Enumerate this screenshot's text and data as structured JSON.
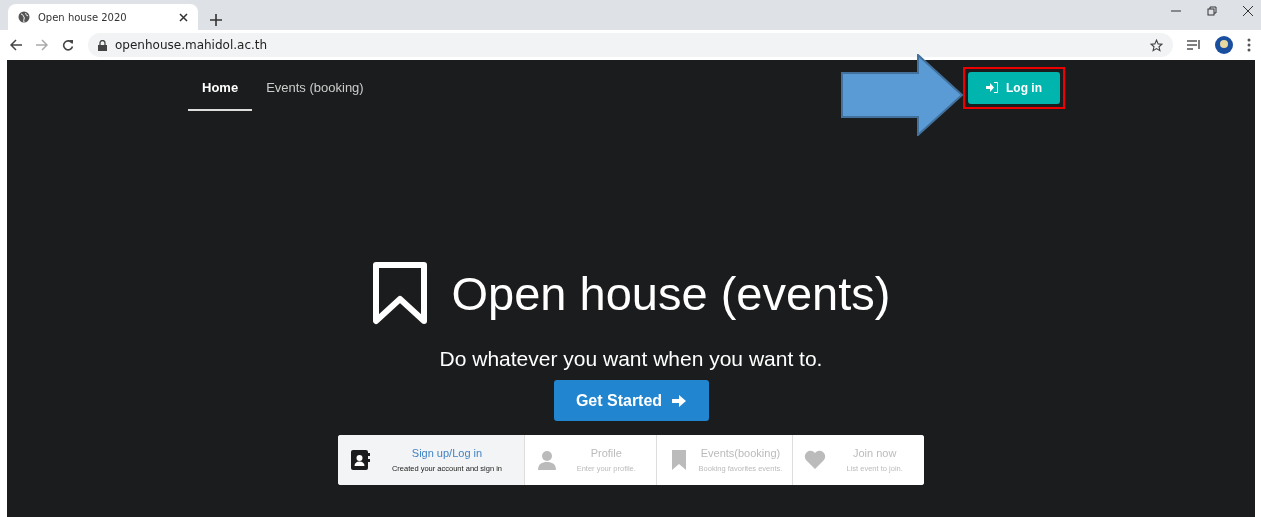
{
  "browser": {
    "tab_title": "Open house 2020",
    "url": "openhouse.mahidol.ac.th"
  },
  "nav": {
    "items": [
      {
        "label": "Home",
        "selected": true
      },
      {
        "label": "Events (booking)",
        "selected": false
      }
    ],
    "login_button": "Log in",
    "login_highlighted": true,
    "pointer_arrow": true
  },
  "hero": {
    "title": "Open house (events)",
    "subtitle": "Do whatever you want when you want to.",
    "cta": "Get Started"
  },
  "steps": [
    {
      "title": "Sign up/Log in",
      "description": "Created your account and sign in",
      "selected": true
    },
    {
      "title": "Profile",
      "description": "Enter your profile.",
      "selected": false
    },
    {
      "title": "Events(booking)",
      "description": "Booking favorites events.",
      "selected": false
    },
    {
      "title": "Join now",
      "description": "List event to join.",
      "selected": false
    }
  ]
}
